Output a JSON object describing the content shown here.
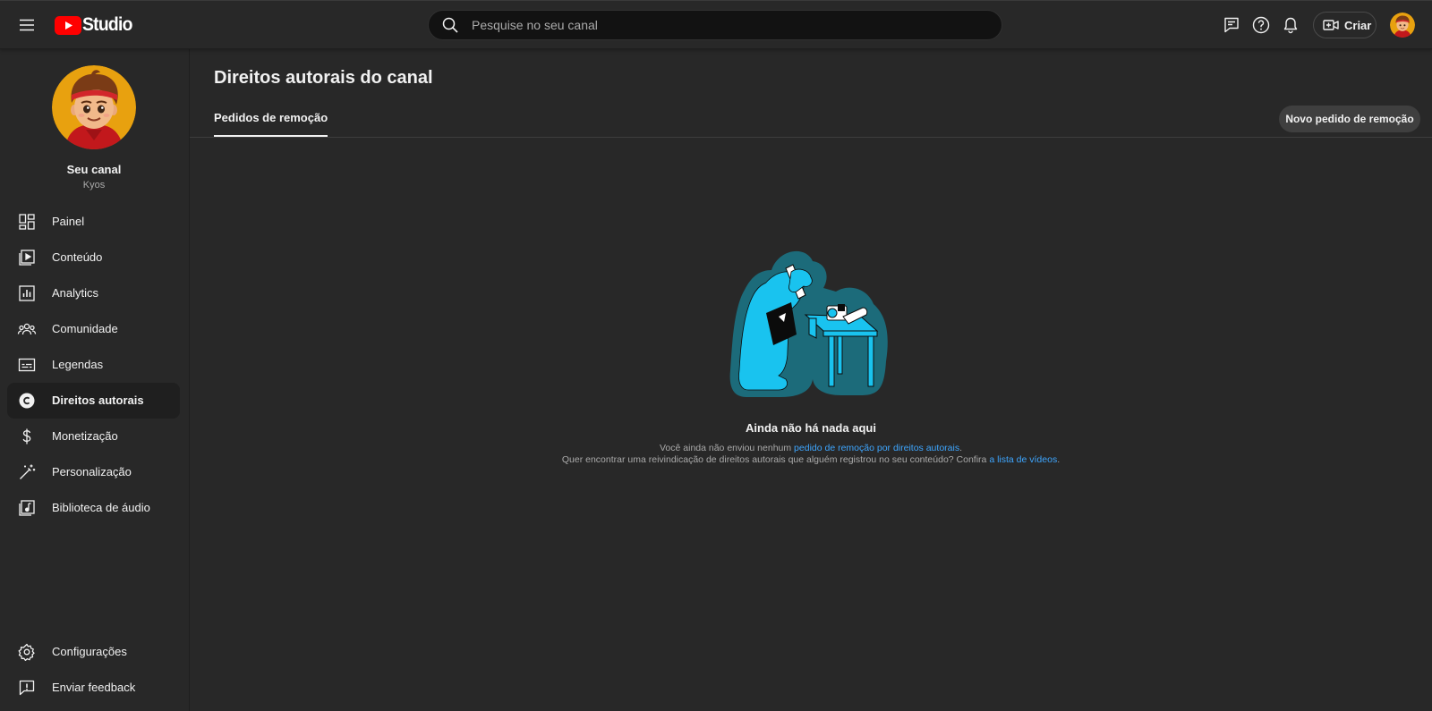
{
  "header": {
    "logo_text": "Studio",
    "search_placeholder": "Pesquise no seu canal",
    "create_label": "Criar",
    "brand_color": "#ff0000",
    "icons": [
      "menu-icon",
      "search-icon",
      "feedback-comment-icon",
      "help-icon",
      "bell-icon",
      "camera-plus-icon"
    ]
  },
  "sidebar": {
    "channel_name": "Seu canal",
    "channel_handle": "Kyos",
    "items": [
      {
        "label": "Painel",
        "icon": "dashboard-icon",
        "active": false
      },
      {
        "label": "Conteúdo",
        "icon": "content-icon",
        "active": false
      },
      {
        "label": "Analytics",
        "icon": "analytics-icon",
        "active": false
      },
      {
        "label": "Comunidade",
        "icon": "community-icon",
        "active": false
      },
      {
        "label": "Legendas",
        "icon": "subtitles-icon",
        "active": false
      },
      {
        "label": "Direitos autorais",
        "icon": "copyright-icon",
        "active": true
      },
      {
        "label": "Monetização",
        "icon": "dollar-icon",
        "active": false
      },
      {
        "label": "Personalização",
        "icon": "magic-wand-icon",
        "active": false
      },
      {
        "label": "Biblioteca de áudio",
        "icon": "audio-library-icon",
        "active": false
      }
    ],
    "bottom_items": [
      {
        "label": "Configurações",
        "icon": "gear-icon"
      },
      {
        "label": "Enviar feedback",
        "icon": "feedback-icon"
      }
    ]
  },
  "main": {
    "title": "Direitos autorais do canal",
    "tab_label": "Pedidos de remoção",
    "new_request_label": "Novo pedido de remoção",
    "empty": {
      "title": "Ainda não há nada aqui",
      "line1_prefix": "Você ainda não enviou nenhum ",
      "line1_link": "pedido de remoção por direitos autorais",
      "line1_suffix": ".",
      "line2_prefix": "Quer encontrar uma reivindicação de direitos autorais que alguém registrou no seu conteúdo? Confira ",
      "line2_link": "a lista de vídeos",
      "line2_suffix": "."
    },
    "link_color": "#3ea6ff"
  }
}
